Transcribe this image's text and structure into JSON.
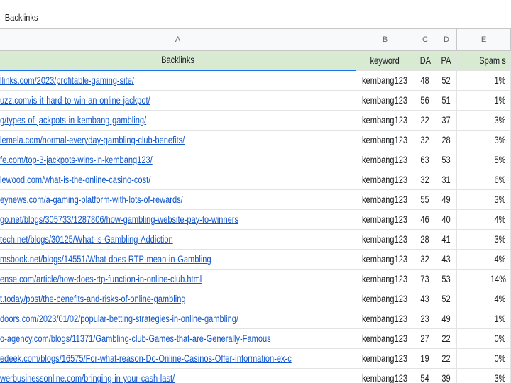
{
  "formula_bar": {
    "cell_content": "Backlinks"
  },
  "columns": [
    "A",
    "B",
    "C",
    "D",
    "E"
  ],
  "header_row": {
    "backlinks": "Backlinks",
    "keyword": "keyword",
    "da": "DA",
    "pa": "PA",
    "spam": "Spam s"
  },
  "rows": [
    {
      "url": "llinks.com/2023/profitable-gaming-site/",
      "keyword": "kembang123",
      "da": "48",
      "pa": "52",
      "spam": "1%"
    },
    {
      "url": "uzz.com/is-it-hard-to-win-an-online-jackpot/",
      "keyword": "kembang123",
      "da": "56",
      "pa": "51",
      "spam": "1%"
    },
    {
      "url": "g/types-of-jackpots-in-kembang-gambling/",
      "keyword": "kembang123",
      "da": "22",
      "pa": "37",
      "spam": "3%"
    },
    {
      "url": "lemela.com/normal-everyday-gambling-club-benefits/",
      "keyword": "kembang123",
      "da": "32",
      "pa": "28",
      "spam": "3%"
    },
    {
      "url": "fe.com/top-3-jackpots-wins-in-kembang123/",
      "keyword": "kembang123",
      "da": "63",
      "pa": "53",
      "spam": "5%"
    },
    {
      "url": "lewood.com/what-is-the-online-casino-cost/",
      "keyword": "kembang123",
      "da": "32",
      "pa": "31",
      "spam": "6%"
    },
    {
      "url": "eynews.com/a-gaming-platform-with-lots-of-rewards/",
      "keyword": "kembang123",
      "da": "55",
      "pa": "49",
      "spam": "3%"
    },
    {
      "url": "go.net/blogs/305733/1287806/how-gambling-website-pay-to-winners",
      "keyword": "kembang123",
      "da": "46",
      "pa": "40",
      "spam": "4%"
    },
    {
      "url": "tech.net/blogs/30125/What-is-Gambling-Addiction",
      "keyword": "kembang123",
      "da": "28",
      "pa": "41",
      "spam": "3%"
    },
    {
      "url": "msbook.net/blogs/14551/What-does-RTP-mean-in-Gambling",
      "keyword": "kembang123",
      "da": "32",
      "pa": "43",
      "spam": "4%"
    },
    {
      "url": "ense.com/article/how-does-rtp-function-in-online-club.html",
      "keyword": "kembang123",
      "da": "73",
      "pa": "53",
      "spam": "14%"
    },
    {
      "url": "t.today/post/the-benefits-and-risks-of-online-gambling",
      "keyword": "kembang123",
      "da": "43",
      "pa": "52",
      "spam": "4%"
    },
    {
      "url": "doors.com/2023/01/02/popular-betting-strategies-in-online-gambling/",
      "keyword": "kembang123",
      "da": "23",
      "pa": "49",
      "spam": "1%"
    },
    {
      "url": "o-agency.com/blogs/11371/Gambling-club-Games-that-are-Generally-Famous",
      "keyword": "kembang123",
      "da": "27",
      "pa": "22",
      "spam": "0%"
    },
    {
      "url": "edeek.com/blogs/16575/For-what-reason-Do-Online-Casinos-Offer-Information-ex-c",
      "keyword": "kembang123",
      "da": "19",
      "pa": "22",
      "spam": "0%"
    },
    {
      "url": "werbusinessonline.com/bringing-in-your-cash-last/",
      "keyword": "kembang123",
      "da": "54",
      "pa": "39",
      "spam": "3%"
    }
  ]
}
